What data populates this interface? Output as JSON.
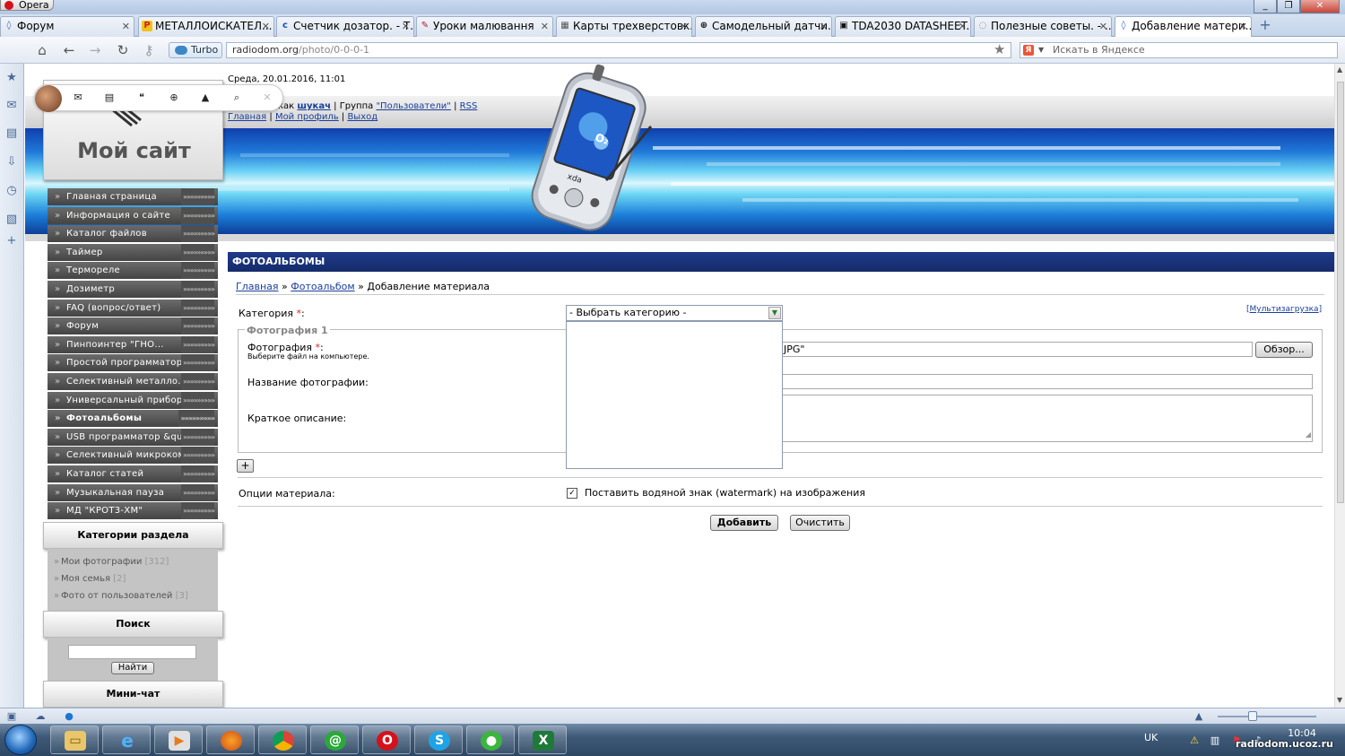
{
  "browser": {
    "name": "Opera",
    "tabs": [
      {
        "label": "Форум",
        "icon": "opera"
      },
      {
        "label": "МЕТАЛЛОИСКАТЕЛ...",
        "icon": "pc"
      },
      {
        "label": "Счетчик дозатор. - Т...",
        "icon": "c2"
      },
      {
        "label": "Уроки малювання",
        "icon": "brush"
      },
      {
        "label": "Карты трехверстовк...",
        "icon": "map"
      },
      {
        "label": "Самодельный датчи...",
        "icon": "cross"
      },
      {
        "label": "TDA2030 DATASHEET...",
        "icon": "doc"
      },
      {
        "label": "Полезные советы. - ...",
        "icon": "loading"
      },
      {
        "label": "Добавление матери...",
        "icon": "opera"
      }
    ],
    "turbo_label": "Turbo",
    "url_host": "radiodom.org",
    "url_path": "/photo/0-0-0-1",
    "search_placeholder": "Искать в Яндексе",
    "search_engine_badge": "Я"
  },
  "site": {
    "date": "Среда, 20.01.2016, 11:01",
    "welcome_prefix": "как",
    "user": "шукач",
    "group_prefix": "| Группа",
    "group": "\"Пользователи\"",
    "rss": "RSS",
    "links": [
      "Главная",
      "Мой профиль",
      "Выход"
    ],
    "logo": "Мой сайт",
    "phone_brand": "xda",
    "phone_logo": "O₂"
  },
  "menu": {
    "arrows": "»»»»»»»»»",
    "items": [
      {
        "label": "Главная страница"
      },
      {
        "label": "Информация о сайте"
      },
      {
        "label": "Каталог файлов"
      },
      {
        "label": "Таймер"
      },
      {
        "label": "Термореле"
      },
      {
        "label": "Дозиметр"
      },
      {
        "label": "FAQ (вопрос/ответ)"
      },
      {
        "label": "Форум"
      },
      {
        "label": "Пинпоинтер \"ГНО..."
      },
      {
        "label": "Простой программатор..."
      },
      {
        "label": "Селективный металло..."
      },
      {
        "label": "Универсальный прибор..."
      },
      {
        "label": "Фотоальбомы"
      },
      {
        "label": "USB программатор &qu..."
      },
      {
        "label": "Селективный микроком..."
      },
      {
        "label": "Каталог статей"
      },
      {
        "label": "Музыкальная пауза"
      },
      {
        "label": "МД \"КРОТ3-ХМ\""
      }
    ]
  },
  "categories": {
    "title": "Категории раздела",
    "items": [
      {
        "label": "Мои фотографии",
        "count": "[312]"
      },
      {
        "label": "Моя семья",
        "count": "[2]"
      },
      {
        "label": "Фото от пользователей",
        "count": "[3]"
      }
    ]
  },
  "search_block": {
    "title": "Поиск",
    "button": "Найти"
  },
  "minichat": {
    "title": "Мини-чат"
  },
  "main": {
    "section_title": "ФОТОАЛЬБОМЫ",
    "breadcrumb": [
      "Главная",
      "Фотоальбом",
      "Добавление материала"
    ],
    "breadcrumb_sep": "»",
    "category_label": "Категория",
    "required_mark": "*",
    "category_select": "- Выбрать категорию -",
    "multiupload": "Мультизагрузка",
    "photo_group": "Фотография 1",
    "photo_label": "Фотография",
    "photo_hint": "Выберите файл на компьютере.",
    "photo_value_tail": "JPG\"",
    "browse_button": "Обзор...",
    "photo_name_label": "Название фотографии:",
    "short_desc_label": "Краткое описание:",
    "add_more": "+",
    "options_label": "Опции материала:",
    "watermark_option": "Поставить водяной знак (watermark) на изображения",
    "submit_button": "Добавить",
    "reset_button": "Очистить"
  },
  "taskbar": {
    "lang": "UK",
    "time": "10:04",
    "apps": [
      "explorer",
      "ie",
      "media-player",
      "firefox",
      "chrome",
      "mail-agent",
      "opera",
      "skype",
      "green-app",
      "excel"
    ],
    "watermark": "radiodom.ucoz.ru"
  }
}
